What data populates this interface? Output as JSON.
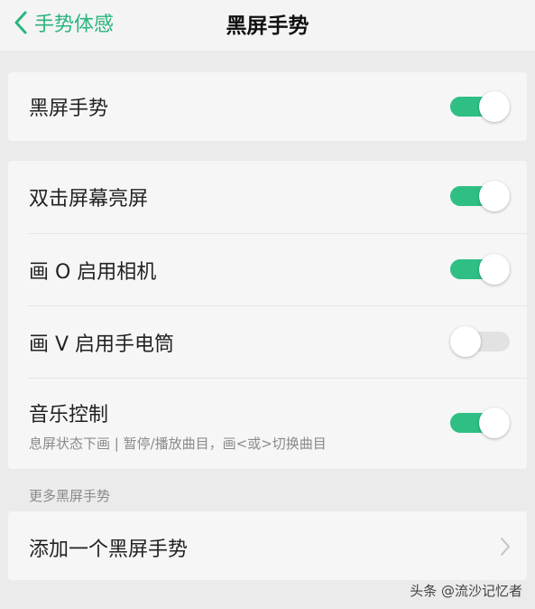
{
  "header": {
    "back_label": "手势体感",
    "title": "黑屏手势"
  },
  "main_switch": {
    "label": "黑屏手势",
    "on": true
  },
  "gestures": [
    {
      "label": "双击屏幕亮屏",
      "on": true
    },
    {
      "label": "画 O 启用相机",
      "on": true
    },
    {
      "label": "画 V 启用手电筒",
      "on": false
    },
    {
      "label": "音乐控制",
      "subtitle": "息屏状态下画 | 暂停/播放曲目，画<或>切换曲目",
      "on": true
    }
  ],
  "more_section": {
    "title": "更多黑屏手势",
    "add_label": "添加一个黑屏手势"
  },
  "watermark": "头条 @流沙记忆者",
  "colors": {
    "accent": "#2ab57d",
    "toggle_on": "#2fbf84",
    "toggle_off": "#e2e2e2"
  }
}
